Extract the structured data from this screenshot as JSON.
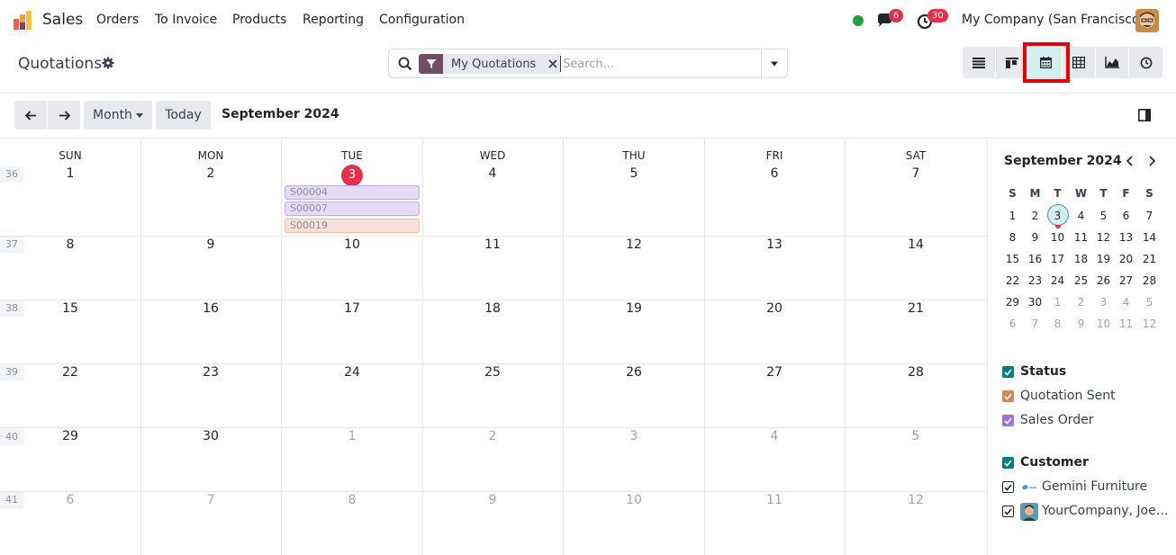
{
  "navbar": {
    "app_name": "Sales",
    "menu": [
      "Orders",
      "To Invoice",
      "Products",
      "Reporting",
      "Configuration"
    ],
    "messages_count": "6",
    "activities_count": "30",
    "company": "My Company (San Francisco)"
  },
  "control_panel": {
    "title": "Quotations",
    "facet_label": "My Quotations",
    "search_placeholder": "Search..."
  },
  "toolbar": {
    "month_label": "Month",
    "today_label": "Today",
    "period": "September 2024"
  },
  "calendar": {
    "weekdays": [
      "SUN",
      "MON",
      "TUE",
      "WED",
      "THU",
      "FRI",
      "SAT"
    ],
    "weeks": [
      {
        "num": "36",
        "days": [
          "1",
          "2",
          "3",
          "4",
          "5",
          "6",
          "7"
        ]
      },
      {
        "num": "37",
        "days": [
          "8",
          "9",
          "10",
          "11",
          "12",
          "13",
          "14"
        ]
      },
      {
        "num": "38",
        "days": [
          "15",
          "16",
          "17",
          "18",
          "19",
          "20",
          "21"
        ]
      },
      {
        "num": "39",
        "days": [
          "22",
          "23",
          "24",
          "25",
          "26",
          "27",
          "28"
        ]
      },
      {
        "num": "40",
        "days": [
          "29",
          "30",
          "1",
          "2",
          "3",
          "4",
          "5"
        ]
      },
      {
        "num": "41",
        "days": [
          "6",
          "7",
          "8",
          "9",
          "10",
          "11",
          "12"
        ]
      }
    ],
    "today": "3",
    "events": [
      {
        "label": "S00004",
        "status": "Sales Order"
      },
      {
        "label": "S00007",
        "status": "Sales Order"
      },
      {
        "label": "S00019",
        "status": "Quotation Sent"
      }
    ]
  },
  "sidebar": {
    "mini_title": "September 2024",
    "mini_weekdays": [
      "S",
      "M",
      "T",
      "W",
      "T",
      "F",
      "S"
    ],
    "mini_weeks": [
      [
        "1",
        "2",
        "3",
        "4",
        "5",
        "6",
        "7"
      ],
      [
        "8",
        "9",
        "10",
        "11",
        "12",
        "13",
        "14"
      ],
      [
        "15",
        "16",
        "17",
        "18",
        "19",
        "20",
        "21"
      ],
      [
        "22",
        "23",
        "24",
        "25",
        "26",
        "27",
        "28"
      ],
      [
        "29",
        "30",
        "1",
        "2",
        "3",
        "4",
        "5"
      ],
      [
        "6",
        "7",
        "8",
        "9",
        "10",
        "11",
        "12"
      ]
    ],
    "status_title": "Status",
    "status_items": [
      "Quotation Sent",
      "Sales Order"
    ],
    "customer_title": "Customer",
    "customer_items": [
      "Gemini Furniture",
      "YourCompany, Joe…"
    ]
  },
  "colors": {
    "brand": "#714b67",
    "accent": "#017e84",
    "today": "#e4304a",
    "quotation_sent": "#d6875a",
    "sales_order": "#a06ee6",
    "highlight": "#e30000"
  }
}
